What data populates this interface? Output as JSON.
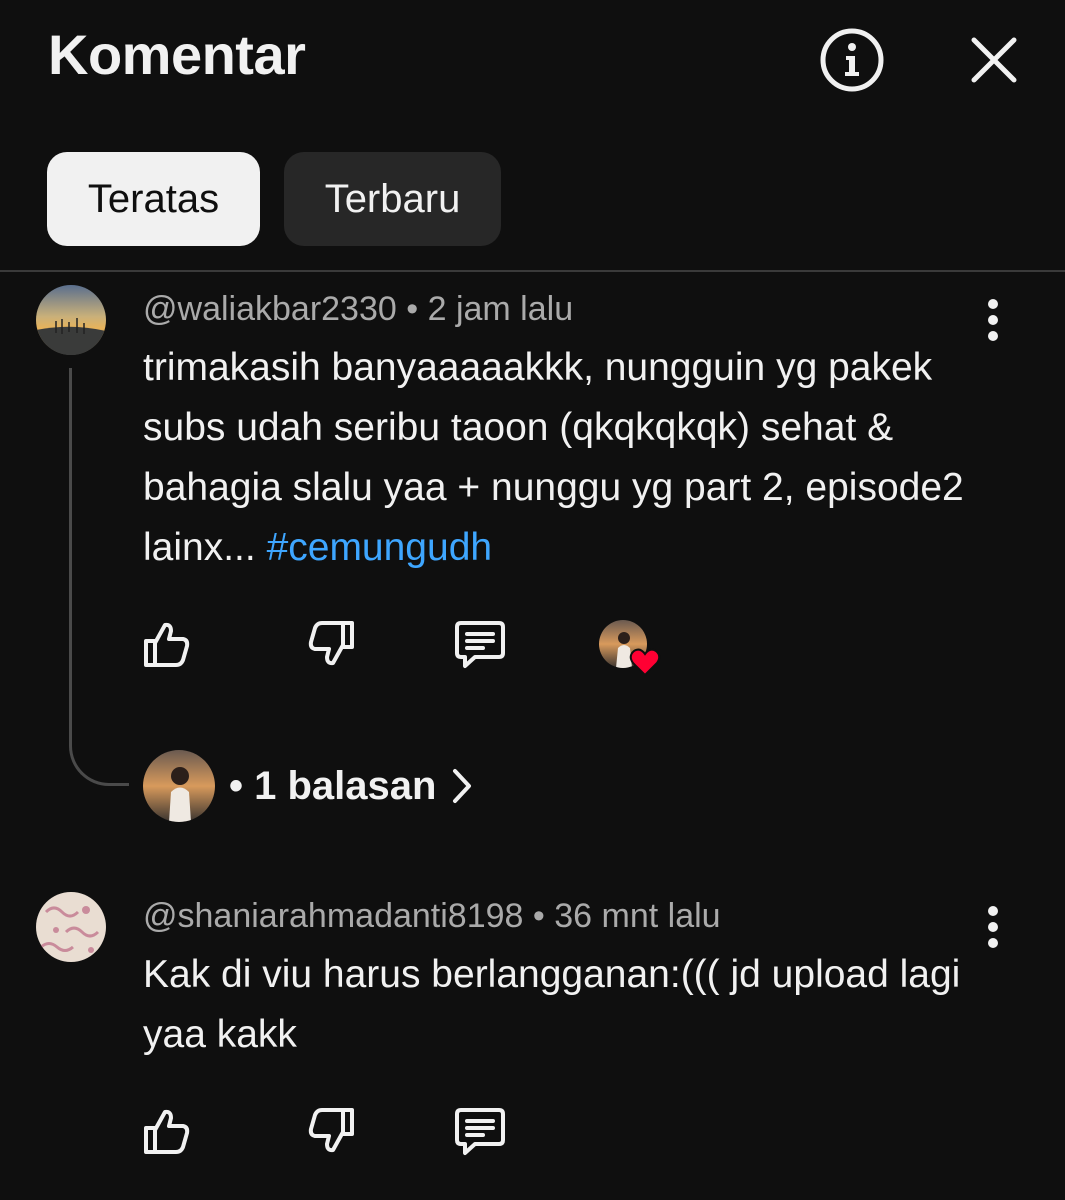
{
  "header": {
    "title": "Komentar"
  },
  "tabs": [
    {
      "label": "Teratas",
      "active": true
    },
    {
      "label": "Terbaru",
      "active": false
    }
  ],
  "comments": [
    {
      "author": "@waliakbar2330",
      "separator": "•",
      "time": "2 jam lalu",
      "text": "trimakasih banyaaaaakkk, nungguin yg pakek subs udah seribu taoon (qkqkqkqk) sehat & bahagia slalu yaa + nunggu yg part 2, episode2 lainx... ",
      "hashtag": "#cemungudh",
      "creator_heart": true,
      "replies_label": "• 1 balasan"
    },
    {
      "author": "@shaniarahmadanti8198",
      "separator": "•",
      "time": "36 mnt lalu",
      "text": "Kak di viu harus berlangganan:((( jd upload lagi yaa kakk"
    }
  ],
  "colors": {
    "background": "#0f0f0f",
    "text": "#f1f1f1",
    "meta": "#aaaaaa",
    "hashtag": "#3ea6ff",
    "heart": "#ff0033",
    "chip_active_bg": "#f1f1f1",
    "chip_inactive_bg": "#272727"
  },
  "icons": [
    "info-icon",
    "close-icon",
    "like-icon",
    "dislike-icon",
    "reply-icon",
    "more-vert-icon",
    "heart-icon",
    "chevron-right-icon"
  ]
}
